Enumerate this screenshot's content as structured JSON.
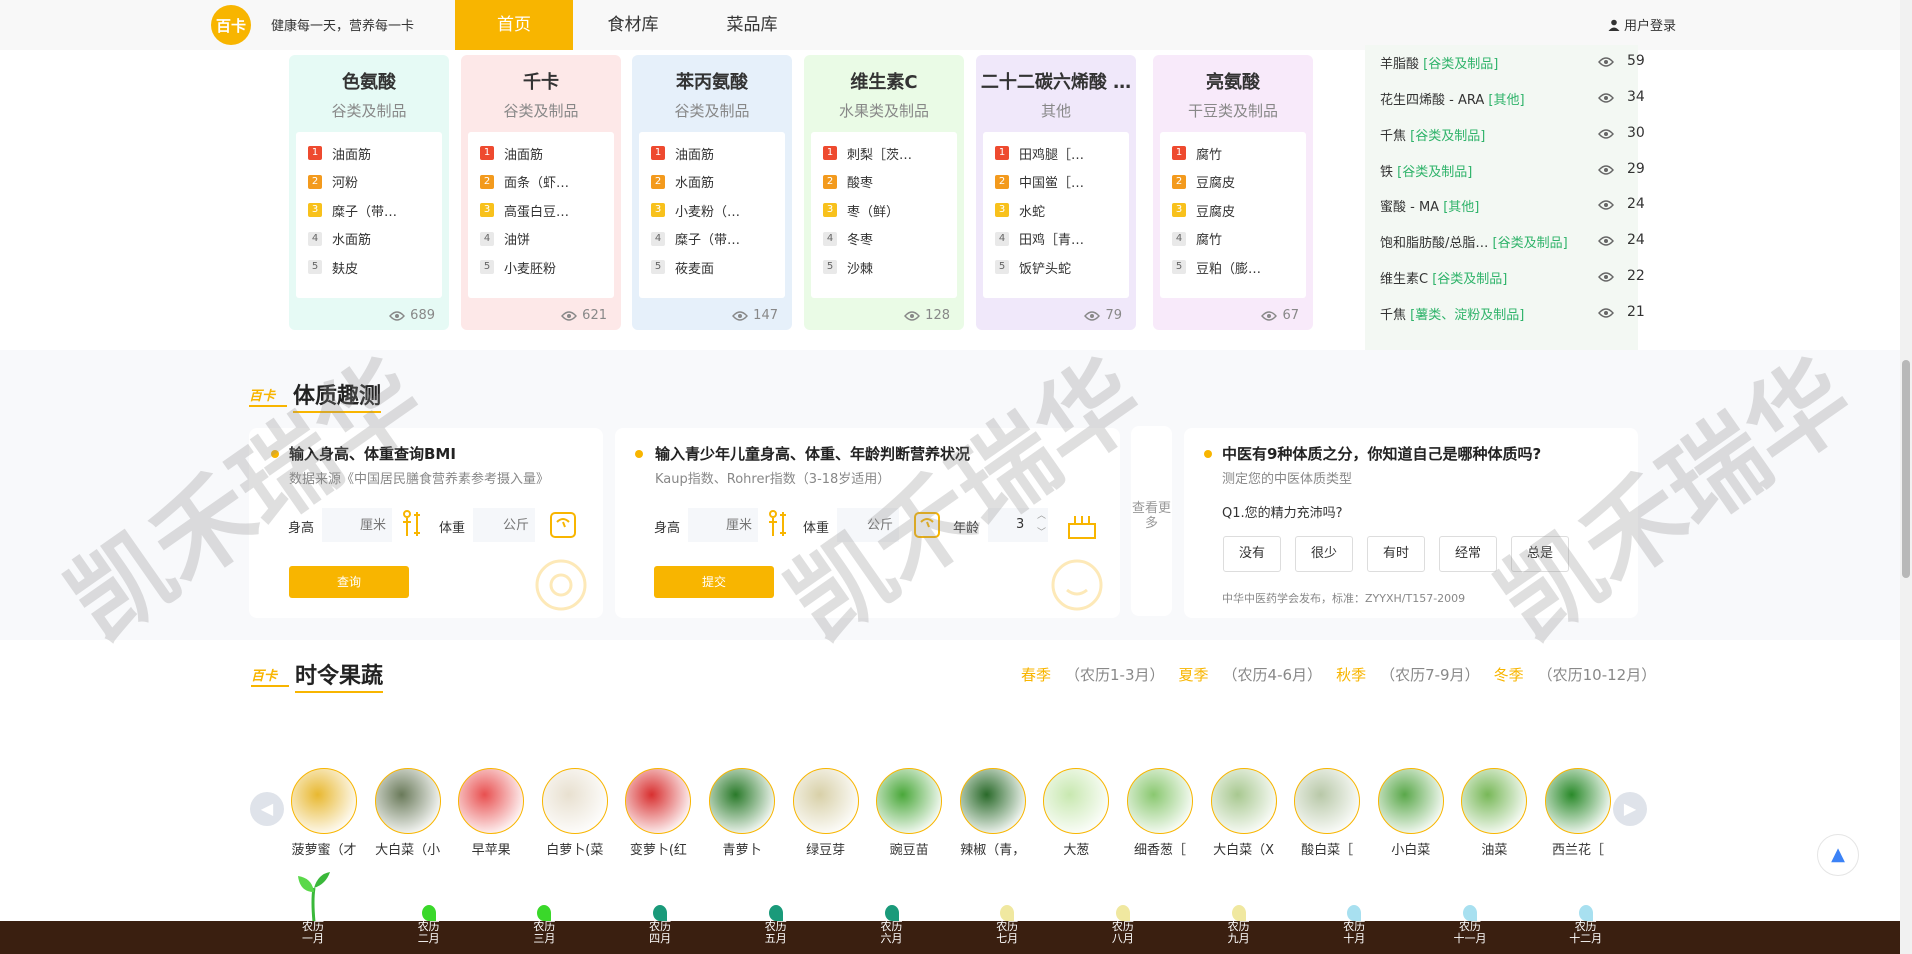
{
  "nav": {
    "logo": "百卡",
    "slogan": "健康每一天，营养每一卡",
    "links": [
      "首页",
      "食材库",
      "菜品库"
    ],
    "login": "用户登录"
  },
  "rank_cards": [
    {
      "title": "色氨酸",
      "category": "谷类及制品",
      "bg": "#e6faf5",
      "items": [
        "油面筋",
        "河粉",
        "糜子（带…",
        "水面筋",
        "麸皮"
      ],
      "views": "689"
    },
    {
      "title": "千卡",
      "category": "谷类及制品",
      "bg": "#fde8e8",
      "items": [
        "油面筋",
        "面条（虾…",
        "高蛋白豆…",
        "油饼",
        "小麦胚粉"
      ],
      "views": "621"
    },
    {
      "title": "苯丙氨酸",
      "category": "谷类及制品",
      "bg": "#e6f0fa",
      "items": [
        "油面筋",
        "水面筋",
        "小麦粉（…",
        "糜子（带…",
        "莜麦面"
      ],
      "views": "147"
    },
    {
      "title": "维生素C",
      "category": "水果类及制品",
      "bg": "#eafbe6",
      "items": [
        "刺梨［茨…",
        "酸枣",
        "枣（鲜）",
        "冬枣",
        "沙棘"
      ],
      "views": "128"
    },
    {
      "title": "二十二碳六烯酸 …",
      "category": "其他",
      "bg": "#f0e8fa",
      "items": [
        "田鸡腿［…",
        "中国鲎［…",
        "水蛇",
        "田鸡［青…",
        "饭铲头蛇"
      ],
      "views": "79"
    },
    {
      "title": "亮氨酸",
      "category": "干豆类及制品",
      "bg": "#f8eafa",
      "items": [
        "腐竹",
        "豆腐皮",
        "豆腐皮",
        "腐竹",
        "豆粕（膨…"
      ],
      "views": "67"
    }
  ],
  "side_list": [
    {
      "name": "羊脂酸",
      "cat": "[谷类及制品]",
      "count": "59"
    },
    {
      "name": "花生四烯酸 - ARA",
      "cat": "[其他]",
      "count": "34"
    },
    {
      "name": "千焦",
      "cat": "[谷类及制品]",
      "count": "30"
    },
    {
      "name": "铁",
      "cat": "[谷类及制品]",
      "count": "29"
    },
    {
      "name": "蜜酸 - MA",
      "cat": "[其他]",
      "count": "24"
    },
    {
      "name": "饱和脂肪酸/总脂…",
      "cat": "[谷类及制品]",
      "count": "24"
    },
    {
      "name": "维生素C",
      "cat": "[谷类及制品]",
      "count": "22"
    },
    {
      "name": "千焦",
      "cat": "[薯类、淀粉及制品]",
      "count": "21"
    }
  ],
  "section_quiz": {
    "logo": "百卡",
    "title": "体质趣测",
    "bmi": {
      "title": "输入身高、体重查询BMI",
      "subtitle": "数据来源《中国居民膳食营养素参考摄入量》",
      "height_label": "身高",
      "height_placeholder": "厘米",
      "weight_label": "体重",
      "weight_placeholder": "公斤",
      "button": "查询"
    },
    "kid": {
      "title": "输入青少年儿童身高、体重、年龄判断营养状况",
      "subtitle": "Kaup指数、Rohrer指数（3-18岁适用）",
      "height_label": "身高",
      "height_placeholder": "厘米",
      "weight_label": "体重",
      "weight_placeholder": "公斤",
      "age_label": "年龄",
      "age_value": "3",
      "button": "提交"
    },
    "more": "查看更多",
    "tcm": {
      "title": "中医有9种体质之分，你知道自己是哪种体质吗?",
      "subtitle": "测定您的中医体质类型",
      "question": "Q1.您的精力充沛吗?",
      "options": [
        "没有",
        "很少",
        "有时",
        "经常",
        "总是"
      ],
      "footer": "中华中医药学会发布，标准：ZYYXH/T157-2009"
    }
  },
  "section_season": {
    "logo": "百卡",
    "title": "时令果蔬",
    "seasons": [
      {
        "name": "春季",
        "range": "（农历1-3月）"
      },
      {
        "name": "夏季",
        "range": "（农历4-6月）"
      },
      {
        "name": "秋季",
        "range": "（农历7-9月）"
      },
      {
        "name": "冬季",
        "range": "（农历10-12月）"
      }
    ],
    "veggies": [
      {
        "name": "菠萝蜜（才",
        "color": "#e8b830"
      },
      {
        "name": "大白菜（小",
        "color": "#6a7a5a"
      },
      {
        "name": "早苹果",
        "color": "#e85050"
      },
      {
        "name": "白萝卜(菜",
        "color": "#e8e0d0"
      },
      {
        "name": "变萝卜(红",
        "color": "#d83030"
      },
      {
        "name": "青萝卜",
        "color": "#2a7a2a"
      },
      {
        "name": "绿豆芽",
        "color": "#d8d0a8"
      },
      {
        "name": "豌豆苗",
        "color": "#4aa83a"
      },
      {
        "name": "辣椒（青，",
        "color": "#2a6a2a"
      },
      {
        "name": "大葱",
        "color": "#c8e8b0"
      },
      {
        "name": "细香葱［",
        "color": "#8ac870"
      },
      {
        "name": "大白菜（X",
        "color": "#a8c890"
      },
      {
        "name": "酸白菜［",
        "color": "#b8c8a8"
      },
      {
        "name": "小白菜",
        "color": "#5aa84a"
      },
      {
        "name": "油菜",
        "color": "#78b858"
      },
      {
        "name": "西兰花［",
        "color": "#2a8a2a"
      }
    ],
    "months": [
      "农历一月",
      "农历二月",
      "农历三月",
      "农历四月",
      "农历五月",
      "农历六月",
      "农历七月",
      "农历八月",
      "农历九月",
      "农历十月",
      "农历十一月",
      "农历十二月"
    ],
    "month_colors": [
      "#6bd84a",
      "#3ad82a",
      "#3ad82a",
      "#1a9a7a",
      "#1a9a7a",
      "#1a9a7a",
      "#f0e8a0",
      "#f0e8a0",
      "#f0e8a0",
      "#a8e0f0",
      "#a8e0f0",
      "#a8e0f0"
    ]
  },
  "watermark": "凯禾瑞华",
  "colors": {
    "accent": "#f8b500",
    "green": "#2fb36a"
  }
}
